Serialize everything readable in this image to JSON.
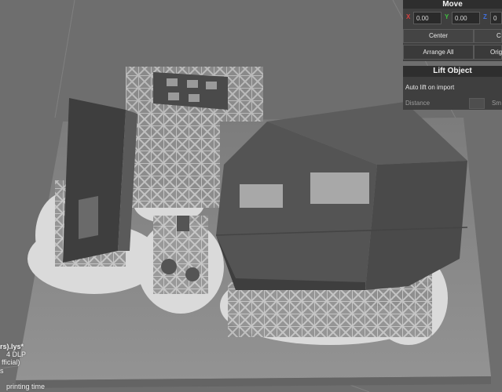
{
  "move_panel": {
    "title": "Move",
    "x_label": "X",
    "x_value": "0.00",
    "y_label": "Y",
    "y_value": "0.00",
    "z_label": "Z",
    "z_value": "0",
    "center_label": "Center",
    "center_partial": "C",
    "arrange_all_label": "Arrange All",
    "origin_label": "Origi"
  },
  "lift_panel": {
    "title": "Lift Object",
    "auto_lift_label": "Auto lift on import",
    "distance_label": "Distance",
    "smart_label": "Sm"
  },
  "file_info": {
    "file_name": "rs).lys*",
    "printer": "4 DLP",
    "profile": "fficial)",
    "extra": "s",
    "printing_time_label": "printing time"
  },
  "colors": {
    "x_axis": "#d84040",
    "y_axis": "#40c040",
    "z_axis": "#4070e0",
    "panel": "#3f3f3f",
    "viewport": "#6e6e6e",
    "build_plate": "#8a8a8a",
    "model": "#505050",
    "supports": "#b5b5b5",
    "raft": "#dcdcdc"
  }
}
